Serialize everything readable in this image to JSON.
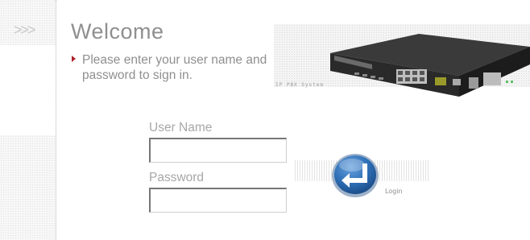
{
  "header": {
    "arrows": ">>>",
    "title": "Welcome",
    "instructions": "Please enter your user name and password to sign in."
  },
  "device": {
    "caption": "IP PBX System"
  },
  "form": {
    "username_label": "User Name",
    "username_value": "",
    "password_label": "Password",
    "password_value": "",
    "login_label": "Login"
  },
  "colors": {
    "accent": "#b0212b",
    "button_blue": "#2f6fb6",
    "text_gray": "#8f8f8f"
  },
  "icons": {
    "login": "enter-arrow-icon",
    "bullet": "triangle-bullet-icon"
  }
}
